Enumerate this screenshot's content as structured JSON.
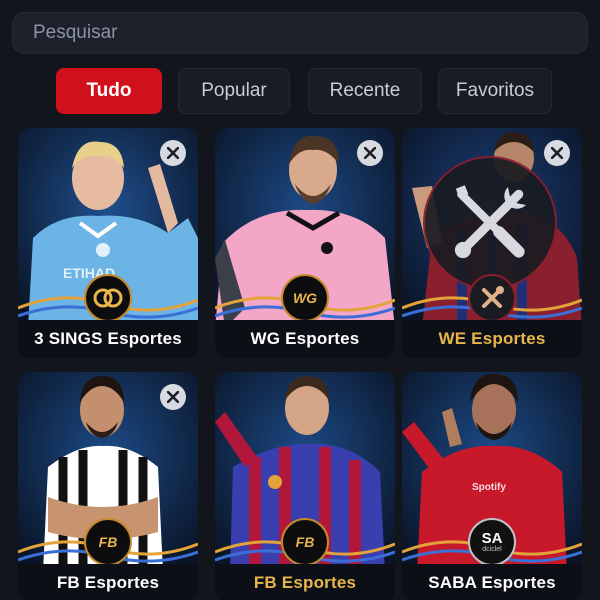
{
  "search": {
    "placeholder": "Pesquisar"
  },
  "tabs": [
    {
      "label": "Tudo",
      "active": true
    },
    {
      "label": "Popular",
      "active": false
    },
    {
      "label": "Recente",
      "active": false
    },
    {
      "label": "Favoritos",
      "active": false
    }
  ],
  "cards": [
    {
      "name": "3 SINGS Esportes",
      "logo_icon": "rings-icon",
      "highlight": false,
      "kit_color": "#6cb4e6",
      "removable": true
    },
    {
      "name": "WG Esportes",
      "logo": "WG",
      "logo_icon": "wg-logo-icon",
      "highlight": false,
      "kit_color": "#f3a6c6",
      "removable": true
    },
    {
      "name": "WE Esportes",
      "logo_icon": "tools-icon",
      "highlight": true,
      "kit_color": "#8a1f2d",
      "removable": true
    },
    {
      "name": "FB Esportes",
      "logo": "FB",
      "logo_icon": "fb-logo-icon",
      "highlight": false,
      "kit_color": "#ffffff",
      "removable": true
    },
    {
      "name": "FB Esportes",
      "logo": "FB",
      "logo_icon": "fb-logo-icon",
      "highlight": true,
      "kit_color": "#3a3fb0",
      "removable": true
    },
    {
      "name": "SABA Esportes",
      "logo": "SA",
      "logo_sub": "dciclel",
      "logo_icon": "saba-logo-icon",
      "highlight": false,
      "kit_color": "#c8192b",
      "removable": true
    }
  ],
  "colors": {
    "accent": "#d0111c",
    "highlight_text": "#e8b54a",
    "background": "#12151c"
  }
}
